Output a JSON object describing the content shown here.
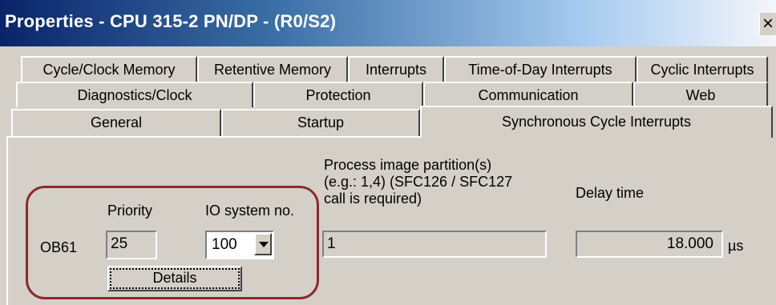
{
  "window": {
    "title": "Properties - CPU 315-2 PN/DP - (R0/S2)",
    "close_label": "×"
  },
  "tabs": {
    "row1": [
      "Cycle/Clock Memory",
      "Retentive Memory",
      "Interrupts",
      "Time-of-Day Interrupts",
      "Cyclic Interrupts"
    ],
    "row2": [
      "Diagnostics/Clock",
      "Protection",
      "Communication",
      "Web"
    ],
    "row3": [
      "General",
      "Startup",
      "Synchronous Cycle Interrupts"
    ],
    "active": "Synchronous Cycle Interrupts"
  },
  "panel": {
    "headers": {
      "priority": "Priority",
      "io_system": "IO system no.",
      "process_image": "Process image partition(s)\n(e.g.: 1,4) (SFC126 / SFC127\ncall is required)",
      "delay_time": "Delay time"
    },
    "row": {
      "ob_label": "OB61",
      "priority_value": "25",
      "io_system_value": "100",
      "process_image_value": "1",
      "delay_value": "18.000",
      "delay_unit": "µs",
      "details_button": "Details"
    }
  },
  "colors": {
    "title_start": "#0a246a",
    "face": "#d4d0c8",
    "highlight": "#8b2a2a"
  }
}
